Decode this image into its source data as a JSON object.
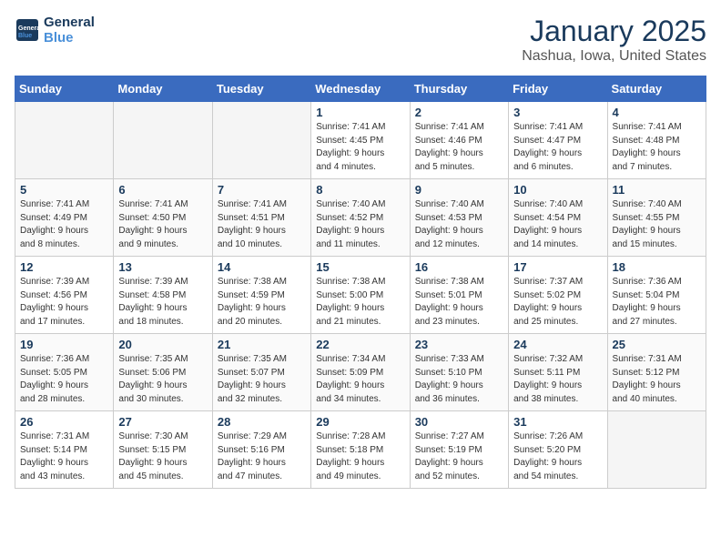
{
  "header": {
    "logo_line1": "General",
    "logo_line2": "Blue",
    "title": "January 2025",
    "subtitle": "Nashua, Iowa, United States"
  },
  "weekdays": [
    "Sunday",
    "Monday",
    "Tuesday",
    "Wednesday",
    "Thursday",
    "Friday",
    "Saturday"
  ],
  "weeks": [
    [
      {
        "day": "",
        "info": "",
        "empty": true
      },
      {
        "day": "",
        "info": "",
        "empty": true
      },
      {
        "day": "",
        "info": "",
        "empty": true
      },
      {
        "day": "1",
        "info": "Sunrise: 7:41 AM\nSunset: 4:45 PM\nDaylight: 9 hours\nand 4 minutes."
      },
      {
        "day": "2",
        "info": "Sunrise: 7:41 AM\nSunset: 4:46 PM\nDaylight: 9 hours\nand 5 minutes."
      },
      {
        "day": "3",
        "info": "Sunrise: 7:41 AM\nSunset: 4:47 PM\nDaylight: 9 hours\nand 6 minutes."
      },
      {
        "day": "4",
        "info": "Sunrise: 7:41 AM\nSunset: 4:48 PM\nDaylight: 9 hours\nand 7 minutes."
      }
    ],
    [
      {
        "day": "5",
        "info": "Sunrise: 7:41 AM\nSunset: 4:49 PM\nDaylight: 9 hours\nand 8 minutes."
      },
      {
        "day": "6",
        "info": "Sunrise: 7:41 AM\nSunset: 4:50 PM\nDaylight: 9 hours\nand 9 minutes."
      },
      {
        "day": "7",
        "info": "Sunrise: 7:41 AM\nSunset: 4:51 PM\nDaylight: 9 hours\nand 10 minutes."
      },
      {
        "day": "8",
        "info": "Sunrise: 7:40 AM\nSunset: 4:52 PM\nDaylight: 9 hours\nand 11 minutes."
      },
      {
        "day": "9",
        "info": "Sunrise: 7:40 AM\nSunset: 4:53 PM\nDaylight: 9 hours\nand 12 minutes."
      },
      {
        "day": "10",
        "info": "Sunrise: 7:40 AM\nSunset: 4:54 PM\nDaylight: 9 hours\nand 14 minutes."
      },
      {
        "day": "11",
        "info": "Sunrise: 7:40 AM\nSunset: 4:55 PM\nDaylight: 9 hours\nand 15 minutes."
      }
    ],
    [
      {
        "day": "12",
        "info": "Sunrise: 7:39 AM\nSunset: 4:56 PM\nDaylight: 9 hours\nand 17 minutes."
      },
      {
        "day": "13",
        "info": "Sunrise: 7:39 AM\nSunset: 4:58 PM\nDaylight: 9 hours\nand 18 minutes."
      },
      {
        "day": "14",
        "info": "Sunrise: 7:38 AM\nSunset: 4:59 PM\nDaylight: 9 hours\nand 20 minutes."
      },
      {
        "day": "15",
        "info": "Sunrise: 7:38 AM\nSunset: 5:00 PM\nDaylight: 9 hours\nand 21 minutes."
      },
      {
        "day": "16",
        "info": "Sunrise: 7:38 AM\nSunset: 5:01 PM\nDaylight: 9 hours\nand 23 minutes."
      },
      {
        "day": "17",
        "info": "Sunrise: 7:37 AM\nSunset: 5:02 PM\nDaylight: 9 hours\nand 25 minutes."
      },
      {
        "day": "18",
        "info": "Sunrise: 7:36 AM\nSunset: 5:04 PM\nDaylight: 9 hours\nand 27 minutes."
      }
    ],
    [
      {
        "day": "19",
        "info": "Sunrise: 7:36 AM\nSunset: 5:05 PM\nDaylight: 9 hours\nand 28 minutes."
      },
      {
        "day": "20",
        "info": "Sunrise: 7:35 AM\nSunset: 5:06 PM\nDaylight: 9 hours\nand 30 minutes."
      },
      {
        "day": "21",
        "info": "Sunrise: 7:35 AM\nSunset: 5:07 PM\nDaylight: 9 hours\nand 32 minutes."
      },
      {
        "day": "22",
        "info": "Sunrise: 7:34 AM\nSunset: 5:09 PM\nDaylight: 9 hours\nand 34 minutes."
      },
      {
        "day": "23",
        "info": "Sunrise: 7:33 AM\nSunset: 5:10 PM\nDaylight: 9 hours\nand 36 minutes."
      },
      {
        "day": "24",
        "info": "Sunrise: 7:32 AM\nSunset: 5:11 PM\nDaylight: 9 hours\nand 38 minutes."
      },
      {
        "day": "25",
        "info": "Sunrise: 7:31 AM\nSunset: 5:12 PM\nDaylight: 9 hours\nand 40 minutes."
      }
    ],
    [
      {
        "day": "26",
        "info": "Sunrise: 7:31 AM\nSunset: 5:14 PM\nDaylight: 9 hours\nand 43 minutes."
      },
      {
        "day": "27",
        "info": "Sunrise: 7:30 AM\nSunset: 5:15 PM\nDaylight: 9 hours\nand 45 minutes."
      },
      {
        "day": "28",
        "info": "Sunrise: 7:29 AM\nSunset: 5:16 PM\nDaylight: 9 hours\nand 47 minutes."
      },
      {
        "day": "29",
        "info": "Sunrise: 7:28 AM\nSunset: 5:18 PM\nDaylight: 9 hours\nand 49 minutes."
      },
      {
        "day": "30",
        "info": "Sunrise: 7:27 AM\nSunset: 5:19 PM\nDaylight: 9 hours\nand 52 minutes."
      },
      {
        "day": "31",
        "info": "Sunrise: 7:26 AM\nSunset: 5:20 PM\nDaylight: 9 hours\nand 54 minutes."
      },
      {
        "day": "",
        "info": "",
        "empty": true
      }
    ]
  ]
}
